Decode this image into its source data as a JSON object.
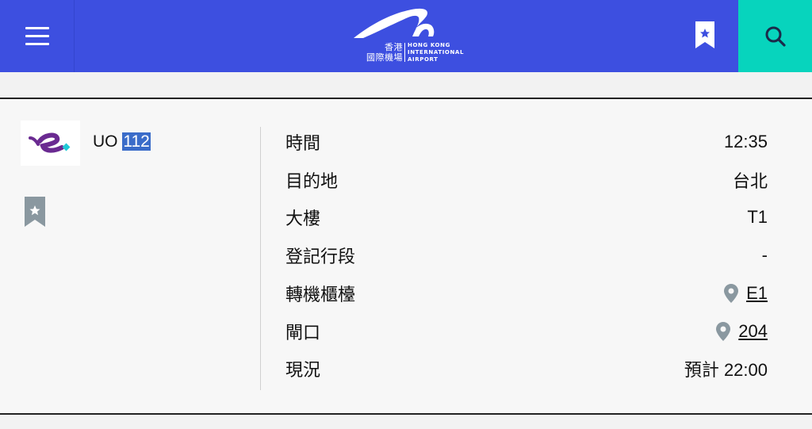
{
  "header": {
    "logo_cn_line1": "香港",
    "logo_cn_line2": "國際機場",
    "logo_en_line1": "HONG KONG",
    "logo_en_line2": "INTERNATIONAL",
    "logo_en_line3": "AIRPORT",
    "brand_color": "#3d4fe0",
    "search_color": "#07d4bd"
  },
  "flight": {
    "code_prefix": "UO",
    "code_number": "112",
    "airline_logo_icon": "hk-express-logo-icon"
  },
  "details": [
    {
      "label": "時間",
      "value": "12:35",
      "link": false
    },
    {
      "label": "目的地",
      "value": "台北",
      "link": false
    },
    {
      "label": "大樓",
      "value": "T1",
      "link": false
    },
    {
      "label": "登記行段",
      "value": "-",
      "link": false
    },
    {
      "label": "轉機櫃檯",
      "value": "E1",
      "link": true
    },
    {
      "label": "閘口",
      "value": "204",
      "link": true
    },
    {
      "label": "現況",
      "value": "預計 22:00",
      "link": false
    }
  ]
}
